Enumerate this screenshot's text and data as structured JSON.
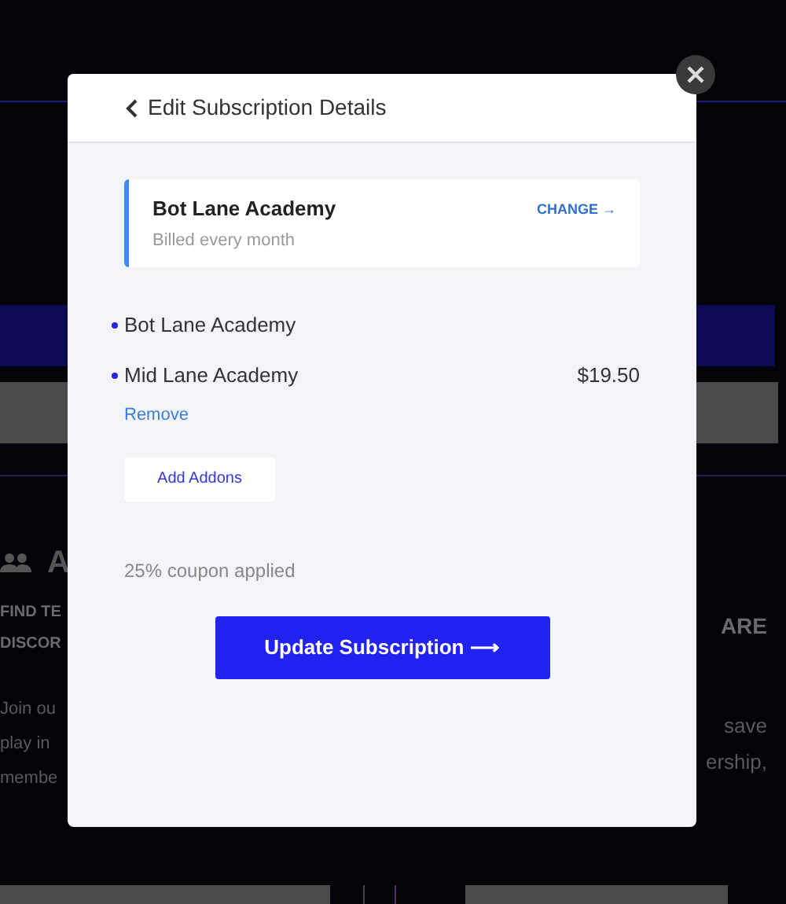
{
  "page_background": {
    "left_heading": "A",
    "left_title_lines": [
      "FIND TE",
      "DISCOR"
    ],
    "left_body_lines": [
      "Join ou",
      "play in",
      "membe"
    ],
    "right_title_lines": [
      "ARE"
    ],
    "right_body_lines": [
      "save",
      "ership,"
    ]
  },
  "modal": {
    "title": "Edit Subscription Details",
    "plan": {
      "name": "Bot Lane Academy",
      "billing": "Billed every month",
      "action": "CHANGE →"
    },
    "addons": [
      {
        "name": "Bot Lane Academy"
      },
      {
        "name": "Mid Lane Academy",
        "price": "$19.50",
        "remove": "Remove"
      }
    ],
    "add_button": "Add Addons",
    "coupon": "25% coupon applied",
    "submit": "Update Subscription ⟶"
  }
}
